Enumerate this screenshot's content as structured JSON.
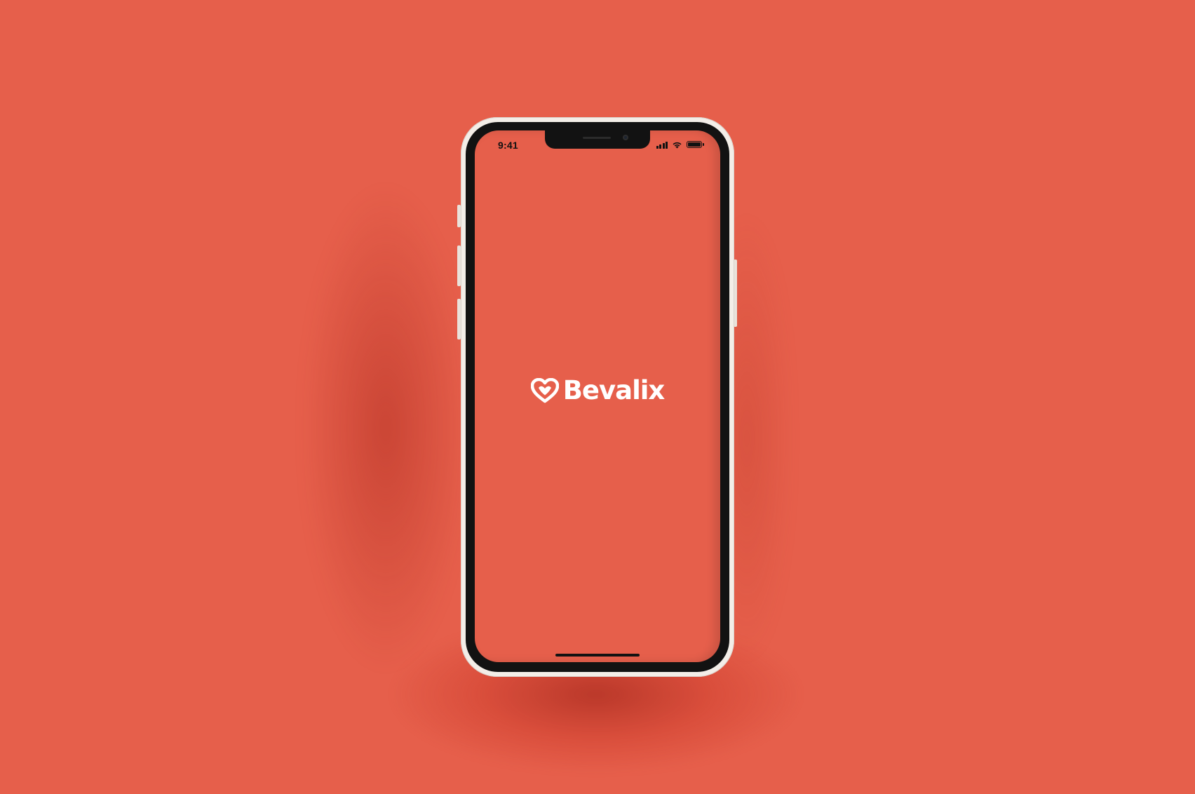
{
  "colors": {
    "background": "#E65F4B",
    "screen": "#E65F4B",
    "logo": "#FFFFFF",
    "bezel": "#121212",
    "frame": "#F3EEE8"
  },
  "status_bar": {
    "time": "9:41",
    "icons": [
      "signal-icon",
      "wifi-icon",
      "battery-icon"
    ]
  },
  "splash": {
    "brand_name": "Bevalix",
    "logo_icon": "heart-icon"
  }
}
